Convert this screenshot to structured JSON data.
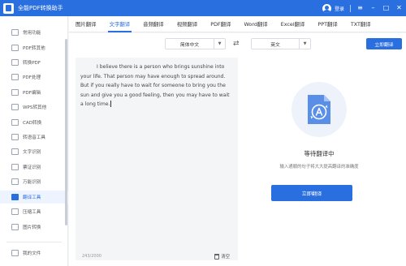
{
  "app": {
    "title": "全能PDF转换助手",
    "login_label": "登录",
    "window_controls": [
      "menu-icon",
      "minimize-icon",
      "maximize-icon",
      "close-icon"
    ]
  },
  "sidebar": {
    "items": [
      {
        "label": "常用功能",
        "icon": "star-icon"
      },
      {
        "label": "PDF转其他",
        "icon": "pdf-export-icon"
      },
      {
        "label": "转换PDF",
        "icon": "to-pdf-icon"
      },
      {
        "label": "PDF处理",
        "icon": "pdf-process-icon"
      },
      {
        "label": "PDF编辑",
        "icon": "pdf-edit-icon"
      },
      {
        "label": "WPS转其他",
        "icon": "wps-icon"
      },
      {
        "label": "CAD转换",
        "icon": "cad-icon"
      },
      {
        "label": "转语音工具",
        "icon": "voice-icon"
      },
      {
        "label": "文字识别",
        "icon": "ocr-icon"
      },
      {
        "label": "票证识别",
        "icon": "ticket-icon"
      },
      {
        "label": "万能识别",
        "icon": "scan-icon"
      },
      {
        "label": "翻译工具",
        "icon": "translate-icon",
        "active": true
      },
      {
        "label": "压缩工具",
        "icon": "compress-icon"
      },
      {
        "label": "图片转换",
        "icon": "image-icon"
      }
    ],
    "bottom_item": {
      "label": "我的文件",
      "icon": "folder-icon"
    }
  },
  "tabs": [
    {
      "label": "图片翻译"
    },
    {
      "label": "文字翻译",
      "active": true
    },
    {
      "label": "音频翻译"
    },
    {
      "label": "视频翻译"
    },
    {
      "label": "PDF翻译"
    },
    {
      "label": "Word翻译"
    },
    {
      "label": "Excel翻译"
    },
    {
      "label": "PPT翻译"
    },
    {
      "label": "TXT翻译"
    }
  ],
  "translate": {
    "source_lang": "简体中文",
    "target_lang": "英文",
    "top_button": "立即翻译",
    "input_text": "I believe there is a person who brings sunshine into your life. That person may have enough to spread around. But if you really have to wait for someone to bring you the sun and give you a good feeling, then you may have to wait a long time.",
    "char_count": "243/2000",
    "clear_label": "清空",
    "waiting_title": "等待翻译中",
    "waiting_tip": "输入通顺的句子将大大提高翻译的准确度",
    "main_button": "立即翻译"
  },
  "colors": {
    "accent": "#2a6fe0",
    "sidebar_active_bg": "#eef4ff",
    "input_bg": "#f4f5f7"
  }
}
